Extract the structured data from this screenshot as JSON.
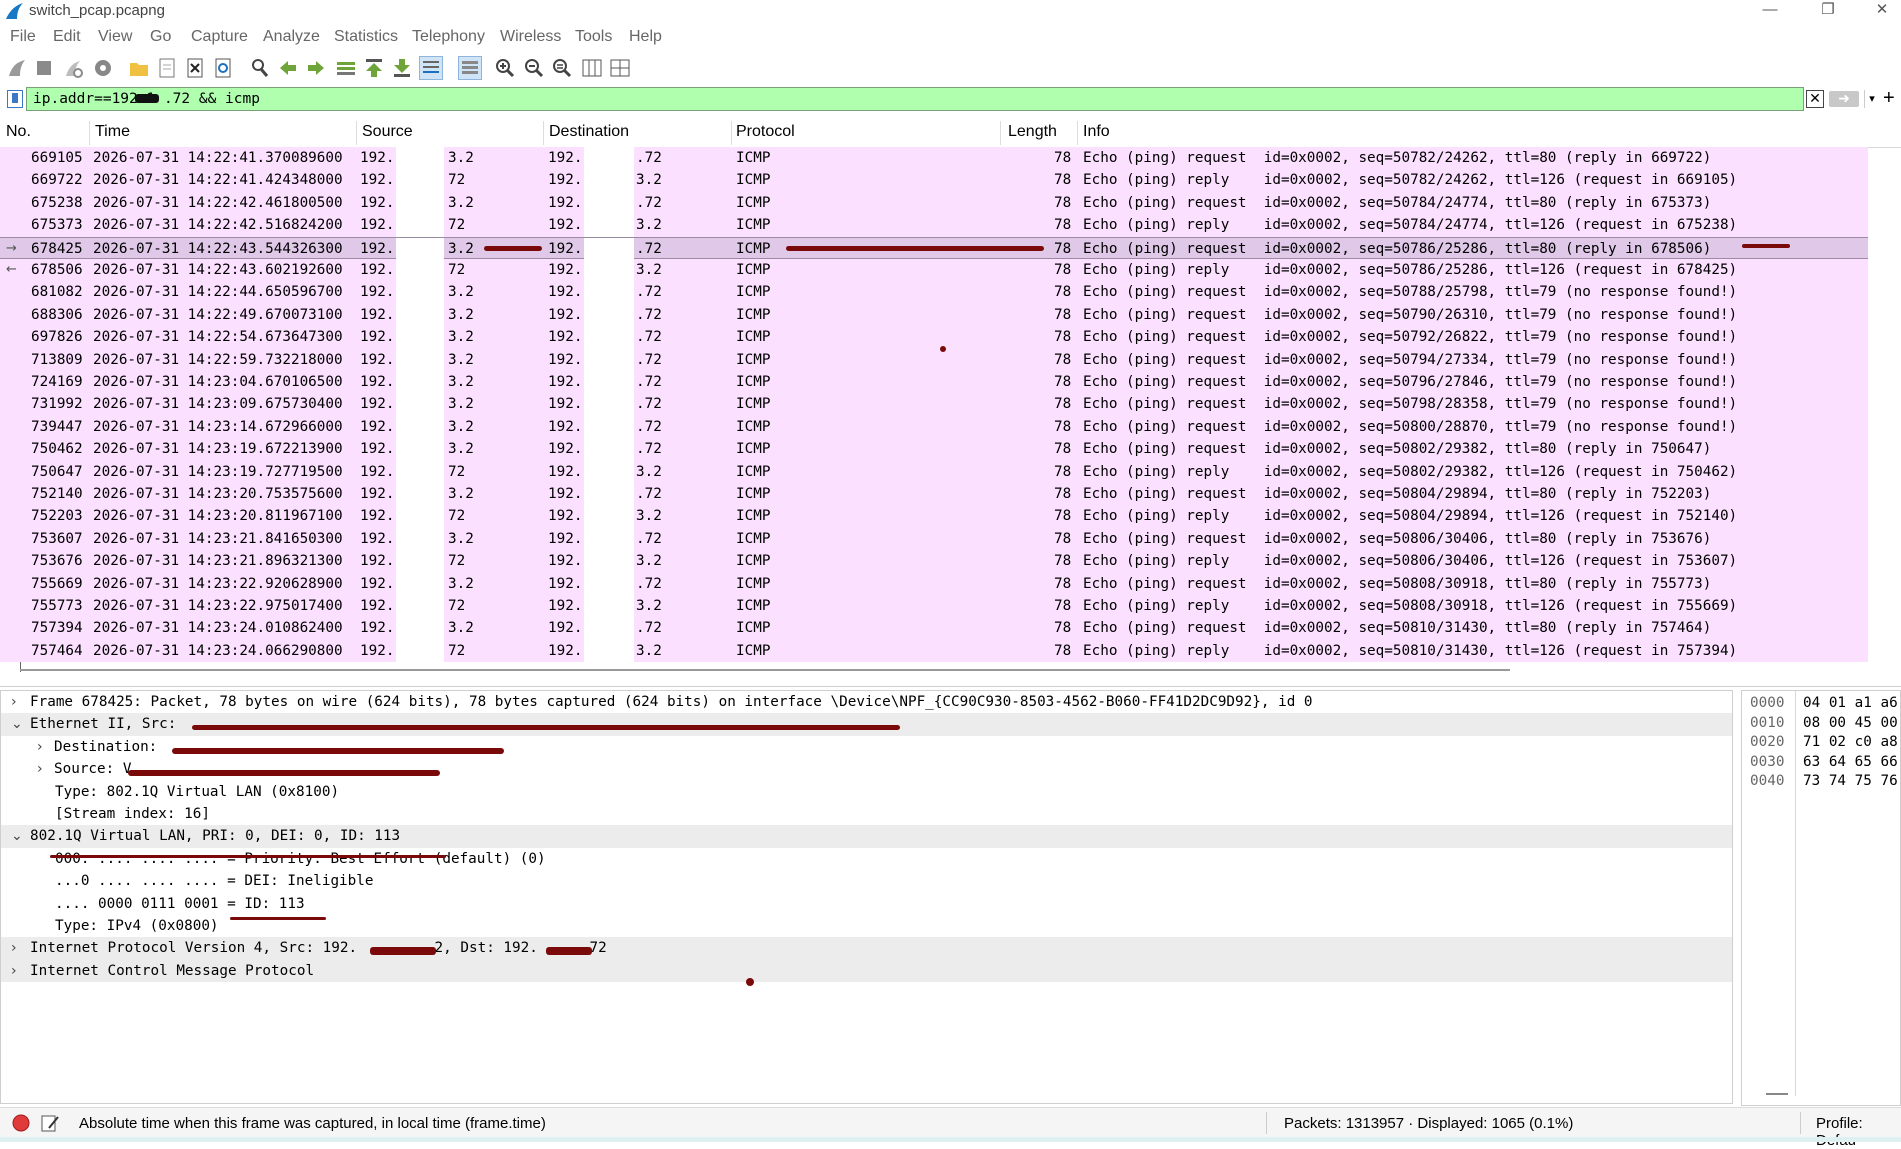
{
  "window": {
    "title": "switch_pcap.pcapng",
    "controls": {
      "minimize": "—",
      "maximize": "❐",
      "close": "✕"
    }
  },
  "menu": [
    "File",
    "Edit",
    "View",
    "Go",
    "Capture",
    "Analyze",
    "Statistics",
    "Telephony",
    "Wireless",
    "Tools",
    "Help"
  ],
  "filter": {
    "value": "ip.addr==192.1   .72 && icmp",
    "clear_glyph": "✕",
    "apply_glyph": "➜",
    "dropdown_glyph": "▾",
    "add_glyph": "+"
  },
  "columns": [
    "No.",
    "Time",
    "Source",
    "Destination",
    "Protocol",
    "Length",
    "Info"
  ],
  "packets": [
    {
      "no": "669105",
      "time": "2026-07-31 14:22:41.370089600",
      "src": "192.",
      "src2": "3.2",
      "dst": "192.",
      "dst2": ".72",
      "proto": "ICMP",
      "len": "78",
      "info": "Echo (ping) request  id=0x0002, seq=50782/24262, ttl=80 (reply in 669722)"
    },
    {
      "no": "669722",
      "time": "2026-07-31 14:22:41.424348000",
      "src": "192.",
      "src2": "72",
      "dst": "192.",
      "dst2": "3.2",
      "proto": "ICMP",
      "len": "78",
      "info": "Echo (ping) reply    id=0x0002, seq=50782/24262, ttl=126 (request in 669105)"
    },
    {
      "no": "675238",
      "time": "2026-07-31 14:22:42.461800500",
      "src": "192.",
      "src2": "3.2",
      "dst": "192.",
      "dst2": ".72",
      "proto": "ICMP",
      "len": "78",
      "info": "Echo (ping) request  id=0x0002, seq=50784/24774, ttl=80 (reply in 675373)"
    },
    {
      "no": "675373",
      "time": "2026-07-31 14:22:42.516824200",
      "src": "192.",
      "src2": "72",
      "dst": "192.",
      "dst2": "3.2",
      "proto": "ICMP",
      "len": "78",
      "info": "Echo (ping) reply    id=0x0002, seq=50784/24774, ttl=126 (request in 675238)"
    },
    {
      "no": "678425",
      "time": "2026-07-31 14:22:43.544326300",
      "src": "192.",
      "src2": "3.2",
      "dst": "192.",
      "dst2": ".72",
      "proto": "ICMP",
      "len": "78",
      "info": "Echo (ping) request  id=0x0002, seq=50786/25286, ttl=80 (reply in 678506)",
      "selected": true,
      "rel": "→"
    },
    {
      "no": "678506",
      "time": "2026-07-31 14:22:43.602192600",
      "src": "192.",
      "src2": "72",
      "dst": "192.",
      "dst2": "3.2",
      "proto": "ICMP",
      "len": "78",
      "info": "Echo (ping) reply    id=0x0002, seq=50786/25286, ttl=126 (request in 678425)",
      "rel": "←"
    },
    {
      "no": "681082",
      "time": "2026-07-31 14:22:44.650596700",
      "src": "192.",
      "src2": "3.2",
      "dst": "192.",
      "dst2": ".72",
      "proto": "ICMP",
      "len": "78",
      "info": "Echo (ping) request  id=0x0002, seq=50788/25798, ttl=79 (no response found!)"
    },
    {
      "no": "688306",
      "time": "2026-07-31 14:22:49.670073100",
      "src": "192.",
      "src2": "3.2",
      "dst": "192.",
      "dst2": ".72",
      "proto": "ICMP",
      "len": "78",
      "info": "Echo (ping) request  id=0x0002, seq=50790/26310, ttl=79 (no response found!)"
    },
    {
      "no": "697826",
      "time": "2026-07-31 14:22:54.673647300",
      "src": "192.",
      "src2": "3.2",
      "dst": "192.",
      "dst2": ".72",
      "proto": "ICMP",
      "len": "78",
      "info": "Echo (ping) request  id=0x0002, seq=50792/26822, ttl=79 (no response found!)"
    },
    {
      "no": "713809",
      "time": "2026-07-31 14:22:59.732218000",
      "src": "192.",
      "src2": "3.2",
      "dst": "192.",
      "dst2": ".72",
      "proto": "ICMP",
      "len": "78",
      "info": "Echo (ping) request  id=0x0002, seq=50794/27334, ttl=79 (no response found!)"
    },
    {
      "no": "724169",
      "time": "2026-07-31 14:23:04.670106500",
      "src": "192.",
      "src2": "3.2",
      "dst": "192.",
      "dst2": ".72",
      "proto": "ICMP",
      "len": "78",
      "info": "Echo (ping) request  id=0x0002, seq=50796/27846, ttl=79 (no response found!)"
    },
    {
      "no": "731992",
      "time": "2026-07-31 14:23:09.675730400",
      "src": "192.",
      "src2": "3.2",
      "dst": "192.",
      "dst2": ".72",
      "proto": "ICMP",
      "len": "78",
      "info": "Echo (ping) request  id=0x0002, seq=50798/28358, ttl=79 (no response found!)"
    },
    {
      "no": "739447",
      "time": "2026-07-31 14:23:14.672966000",
      "src": "192.",
      "src2": "3.2",
      "dst": "192.",
      "dst2": ".72",
      "proto": "ICMP",
      "len": "78",
      "info": "Echo (ping) request  id=0x0002, seq=50800/28870, ttl=79 (no response found!)"
    },
    {
      "no": "750462",
      "time": "2026-07-31 14:23:19.672213900",
      "src": "192.",
      "src2": "3.2",
      "dst": "192.",
      "dst2": ".72",
      "proto": "ICMP",
      "len": "78",
      "info": "Echo (ping) request  id=0x0002, seq=50802/29382, ttl=80 (reply in 750647)"
    },
    {
      "no": "750647",
      "time": "2026-07-31 14:23:19.727719500",
      "src": "192.",
      "src2": "72",
      "dst": "192.",
      "dst2": "3.2",
      "proto": "ICMP",
      "len": "78",
      "info": "Echo (ping) reply    id=0x0002, seq=50802/29382, ttl=126 (request in 750462)"
    },
    {
      "no": "752140",
      "time": "2026-07-31 14:23:20.753575600",
      "src": "192.",
      "src2": "3.2",
      "dst": "192.",
      "dst2": ".72",
      "proto": "ICMP",
      "len": "78",
      "info": "Echo (ping) request  id=0x0002, seq=50804/29894, ttl=80 (reply in 752203)"
    },
    {
      "no": "752203",
      "time": "2026-07-31 14:23:20.811967100",
      "src": "192.",
      "src2": "72",
      "dst": "192.",
      "dst2": "3.2",
      "proto": "ICMP",
      "len": "78",
      "info": "Echo (ping) reply    id=0x0002, seq=50804/29894, ttl=126 (request in 752140)"
    },
    {
      "no": "753607",
      "time": "2026-07-31 14:23:21.841650300",
      "src": "192.",
      "src2": "3.2",
      "dst": "192.",
      "dst2": ".72",
      "proto": "ICMP",
      "len": "78",
      "info": "Echo (ping) request  id=0x0002, seq=50806/30406, ttl=80 (reply in 753676)"
    },
    {
      "no": "753676",
      "time": "2026-07-31 14:23:21.896321300",
      "src": "192.",
      "src2": "72",
      "dst": "192.",
      "dst2": "3.2",
      "proto": "ICMP",
      "len": "78",
      "info": "Echo (ping) reply    id=0x0002, seq=50806/30406, ttl=126 (request in 753607)"
    },
    {
      "no": "755669",
      "time": "2026-07-31 14:23:22.920628900",
      "src": "192.",
      "src2": "3.2",
      "dst": "192.",
      "dst2": ".72",
      "proto": "ICMP",
      "len": "78",
      "info": "Echo (ping) request  id=0x0002, seq=50808/30918, ttl=80 (reply in 755773)"
    },
    {
      "no": "755773",
      "time": "2026-07-31 14:23:22.975017400",
      "src": "192.",
      "src2": "72",
      "dst": "192.",
      "dst2": "3.2",
      "proto": "ICMP",
      "len": "78",
      "info": "Echo (ping) reply    id=0x0002, seq=50808/30918, ttl=126 (request in 755669)"
    },
    {
      "no": "757394",
      "time": "2026-07-31 14:23:24.010862400",
      "src": "192.",
      "src2": "3.2",
      "dst": "192.",
      "dst2": ".72",
      "proto": "ICMP",
      "len": "78",
      "info": "Echo (ping) request  id=0x0002, seq=50810/31430, ttl=80 (reply in 757464)"
    },
    {
      "no": "757464",
      "time": "2026-07-31 14:23:24.066290800",
      "src": "192.",
      "src2": "72",
      "dst": "192.",
      "dst2": "3.2",
      "proto": "ICMP",
      "len": "78",
      "info": "Echo (ping) reply    id=0x0002, seq=50810/31430, ttl=126 (request in 757394)"
    }
  ],
  "details": [
    {
      "indent": 0,
      "arrow": "›",
      "text": "Frame 678425: Packet, 78 bytes on wire (624 bits), 78 bytes captured (624 bits) on interface \\Device\\NPF_{CC90C930-8503-4562-B060-FF41D2DC9D92}, id 0"
    },
    {
      "indent": 0,
      "arrow": "⌄",
      "text": "Ethernet II, Src: ",
      "hl": true
    },
    {
      "indent": 1,
      "arrow": "›",
      "text": "Destination: "
    },
    {
      "indent": 1,
      "arrow": "›",
      "text": "Source: V"
    },
    {
      "indent": 2,
      "arrow": "",
      "text": "Type: 802.1Q Virtual LAN (0x8100)"
    },
    {
      "indent": 2,
      "arrow": "",
      "text": "[Stream index: 16]"
    },
    {
      "indent": 0,
      "arrow": "⌄",
      "text": "802.1Q Virtual LAN, PRI: 0, DEI: 0, ID: 113",
      "hl": true
    },
    {
      "indent": 2,
      "arrow": "",
      "text": "000. .... .... .... = Priority: Best Effort (default) (0)"
    },
    {
      "indent": 2,
      "arrow": "",
      "text": "...0 .... .... .... = DEI: Ineligible"
    },
    {
      "indent": 2,
      "arrow": "",
      "text": ".... 0000 0111 0001 = ID: 113"
    },
    {
      "indent": 2,
      "arrow": "",
      "text": "Type: IPv4 (0x0800)"
    },
    {
      "indent": 0,
      "arrow": "›",
      "text": "Internet Protocol Version 4, Src: 192.        .2, Dst: 192.     .72",
      "hl": true
    },
    {
      "indent": 0,
      "arrow": "›",
      "text": "Internet Control Message Protocol",
      "hl": true
    }
  ],
  "bytes": [
    {
      "offset": "0000",
      "hex": "04 01 a1 a6"
    },
    {
      "offset": "0010",
      "hex": "08 00 45 00"
    },
    {
      "offset": "0020",
      "hex": "71 02 c0 a8"
    },
    {
      "offset": "0030",
      "hex": "63 64 65 66"
    },
    {
      "offset": "0040",
      "hex": "73 74 75 76"
    }
  ],
  "status": {
    "message": "Absolute time when this frame was captured, in local time (frame.time)",
    "packets": "Packets: 1313957 · Displayed: 1065 (0.1%)",
    "profile": "Profile: Defau"
  },
  "colors": {
    "row_icmp": "#fce0ff",
    "row_selected": "#e0c8e8",
    "filter_ok": "#afffaf",
    "redaction": "#7a0a0a"
  }
}
